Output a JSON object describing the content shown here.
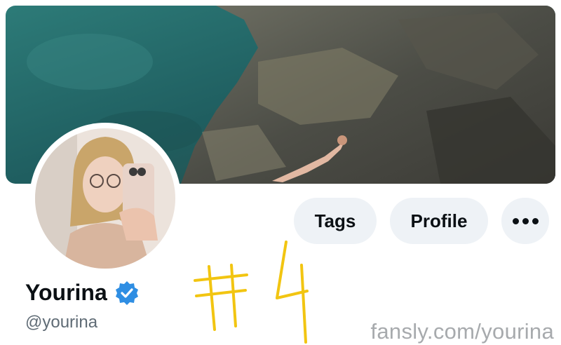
{
  "profile": {
    "display_name": "Yourina",
    "handle": "@yourina",
    "verified": true
  },
  "actions": {
    "tags_label": "Tags",
    "profile_label": "Profile",
    "more_icon": "more-dots-icon"
  },
  "overlay": {
    "handwritten_text": "#4",
    "watermark": "fansly.com/yourina"
  },
  "colors": {
    "pill_bg": "#eef2f6",
    "verified_blue": "#2f8ee3",
    "handwriting_yellow": "#f2c511",
    "watermark_gray": "#a7aaad"
  }
}
